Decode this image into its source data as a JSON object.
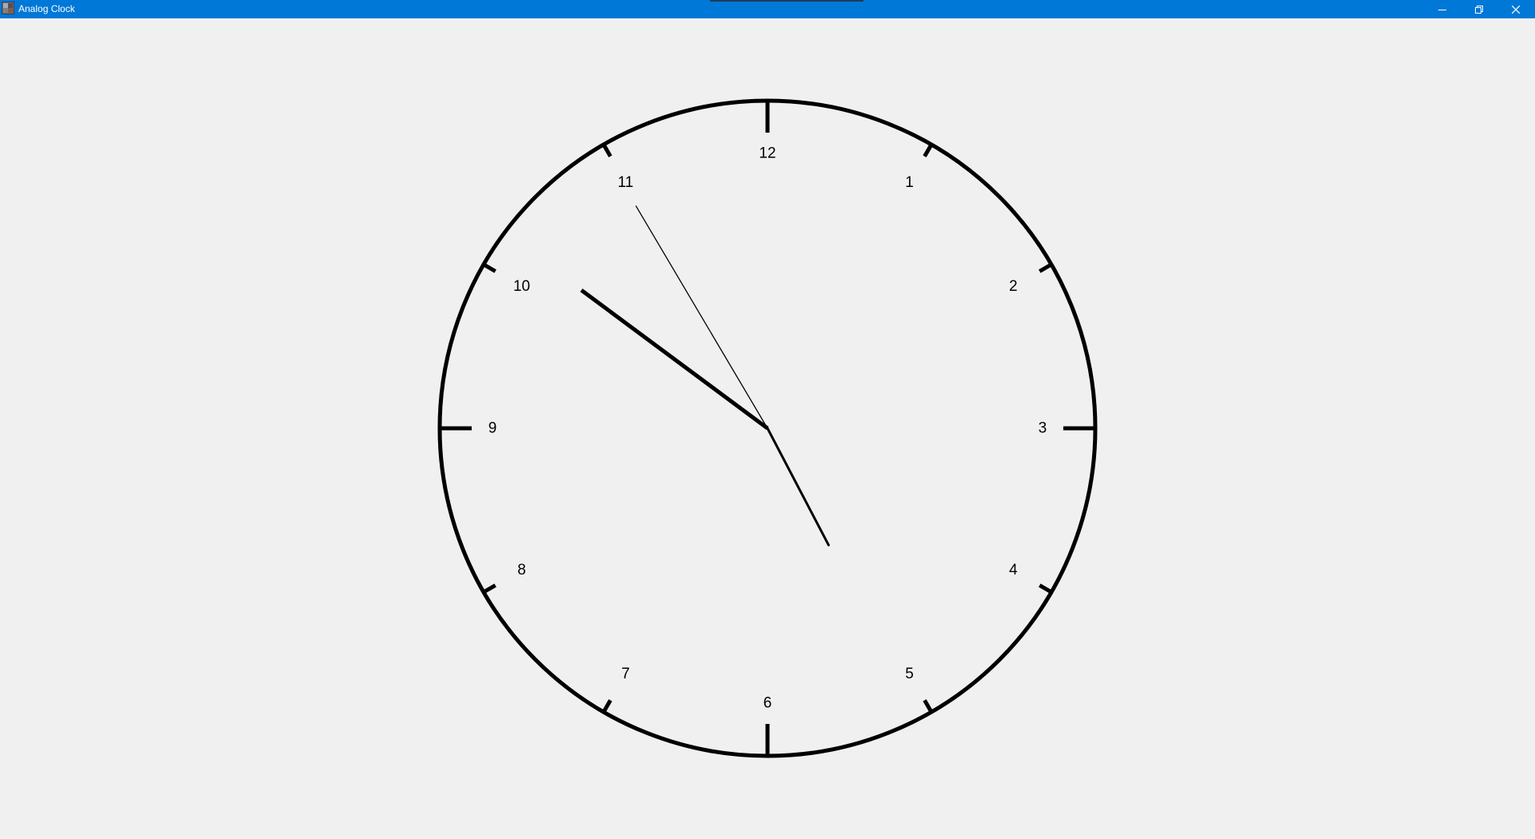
{
  "window": {
    "title": "Analog Clock",
    "app_icon": "app-icon",
    "titlebar_color": "#0078d7",
    "controls": [
      {
        "name": "minimize-button",
        "icon": "minimize-icon"
      },
      {
        "name": "restore-button",
        "icon": "restore-icon"
      },
      {
        "name": "close-button",
        "icon": "close-icon"
      }
    ]
  },
  "clock": {
    "numerals": [
      "12",
      "1",
      "2",
      "3",
      "4",
      "5",
      "6",
      "7",
      "8",
      "9",
      "10",
      "11"
    ],
    "time_shown": {
      "hour_hand_minutes": 51.1,
      "minute_hand_minutes": 25.4,
      "second_hand_minutes": 54.9
    },
    "face_color": "#f0f0f0",
    "stroke_color": "#000000"
  }
}
